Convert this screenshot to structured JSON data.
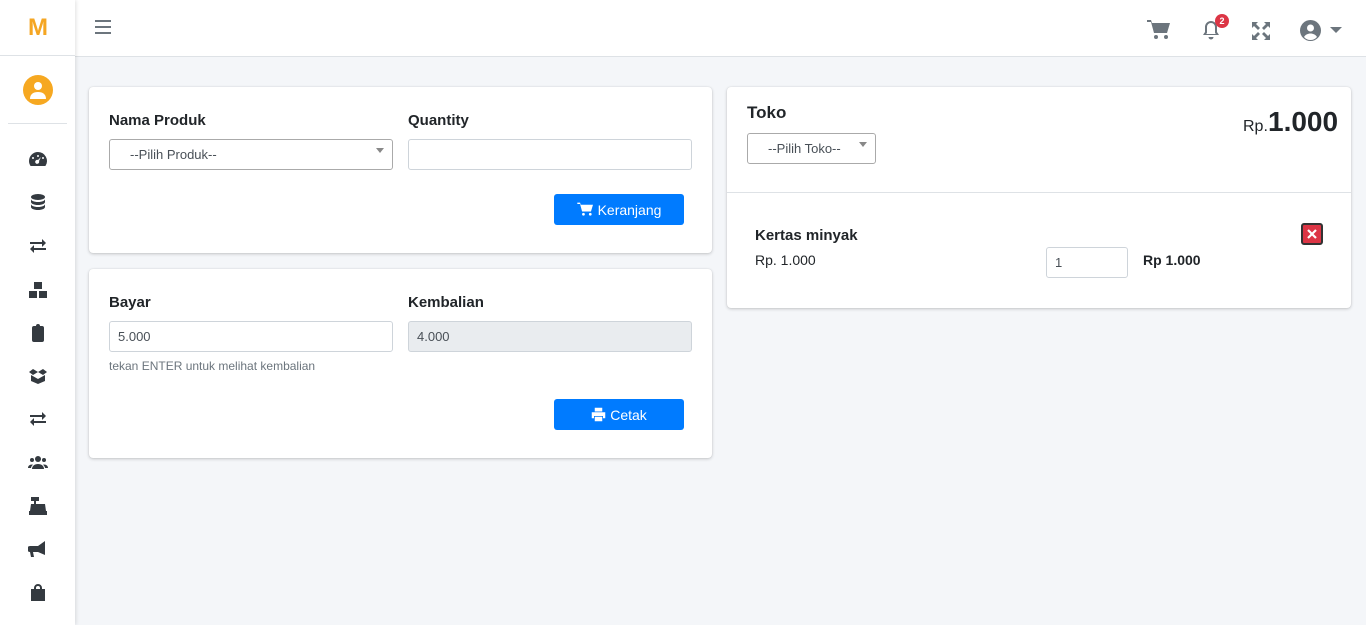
{
  "brand": {
    "logo": "M"
  },
  "topbar": {
    "notification_count": "2"
  },
  "form_add": {
    "product_label": "Nama Produk",
    "product_select": "--Pilih Produk--",
    "quantity_label": "Quantity",
    "quantity_value": "",
    "cart_button": "Keranjang"
  },
  "form_pay": {
    "bayar_label": "Bayar",
    "bayar_value": "5.000",
    "bayar_hint": "tekan ENTER untuk melihat kembalian",
    "kembalian_label": "Kembalian",
    "kembalian_value": "4.000",
    "print_button": "Cetak"
  },
  "cart": {
    "toko_label": "Toko",
    "toko_select": "--Pilih Toko--",
    "total_prefix": "Rp.",
    "total_value": "1.000",
    "items": [
      {
        "name": "Kertas minyak",
        "price": "Rp. 1.000",
        "qty": "1",
        "subtotal": "Rp 1.000"
      }
    ]
  },
  "colors": {
    "accent": "#007bff",
    "danger": "#dc3545",
    "brand": "#f5a623"
  }
}
